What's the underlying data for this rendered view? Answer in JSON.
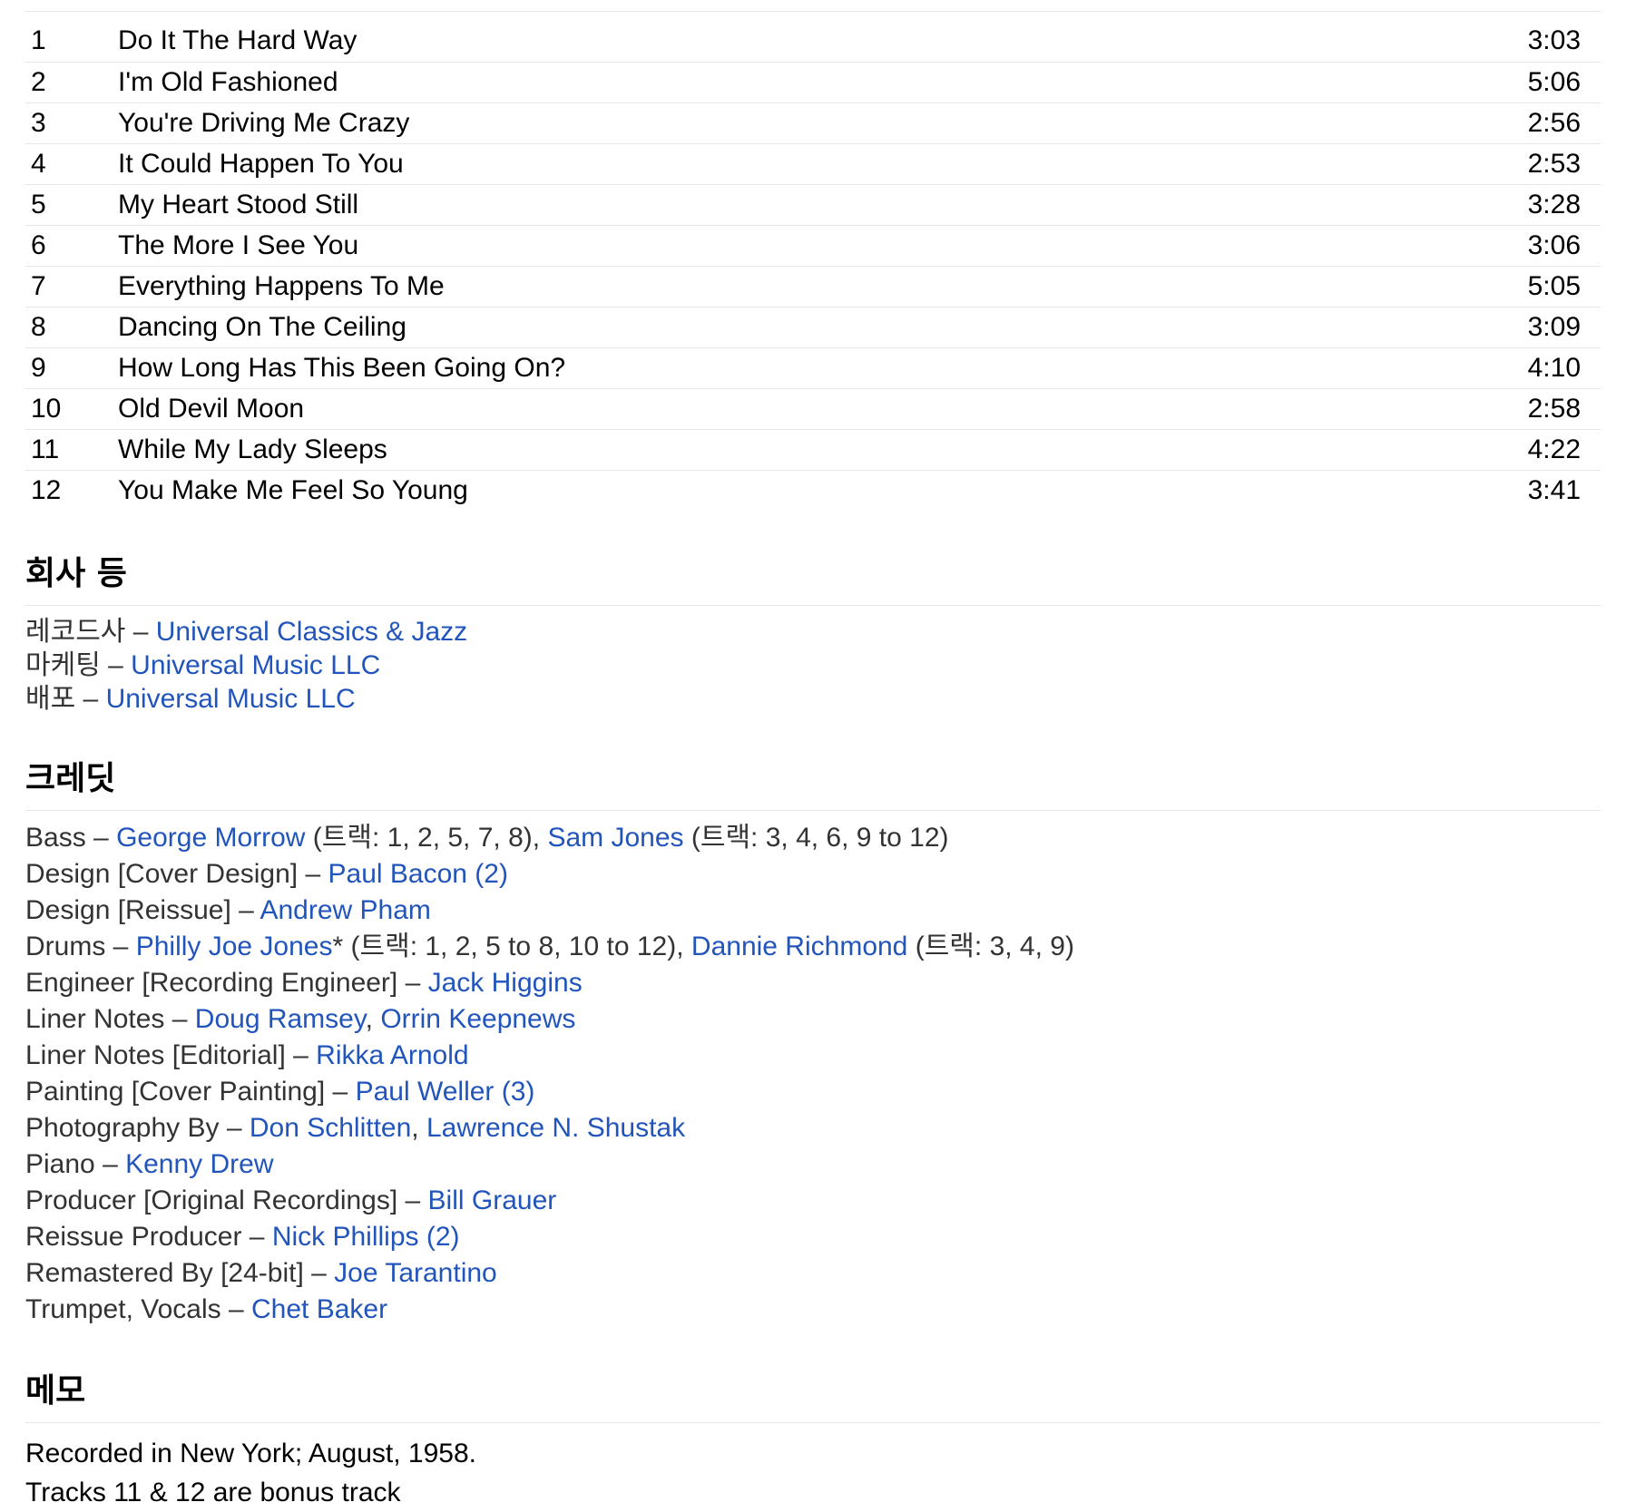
{
  "tracks": [
    {
      "position": "1",
      "title": "Do It The Hard Way",
      "duration": "3:03"
    },
    {
      "position": "2",
      "title": "I'm Old Fashioned",
      "duration": "5:06"
    },
    {
      "position": "3",
      "title": "You're Driving Me Crazy",
      "duration": "2:56"
    },
    {
      "position": "4",
      "title": "It Could Happen To You",
      "duration": "2:53"
    },
    {
      "position": "5",
      "title": "My Heart Stood Still",
      "duration": "3:28"
    },
    {
      "position": "6",
      "title": "The More I See You",
      "duration": "3:06"
    },
    {
      "position": "7",
      "title": "Everything Happens To Me",
      "duration": "5:05"
    },
    {
      "position": "8",
      "title": "Dancing On The Ceiling",
      "duration": "3:09"
    },
    {
      "position": "9",
      "title": "How Long Has This Been Going On?",
      "duration": "4:10"
    },
    {
      "position": "10",
      "title": "Old Devil Moon",
      "duration": "2:58"
    },
    {
      "position": "11",
      "title": "While My Lady Sleeps",
      "duration": "4:22"
    },
    {
      "position": "12",
      "title": "You Make Me Feel So Young",
      "duration": "3:41"
    }
  ],
  "companies": {
    "heading": "회사 등",
    "items": [
      {
        "role": "레코드사",
        "sep": " – ",
        "name": "Universal Classics & Jazz"
      },
      {
        "role": "마케팅",
        "sep": " – ",
        "name": "Universal Music LLC"
      },
      {
        "role": "배포",
        "sep": " – ",
        "name": "Universal Music LLC"
      }
    ]
  },
  "credits": {
    "heading": "크레딧",
    "items": [
      {
        "role": "Bass",
        "parts": [
          {
            "type": "link",
            "text": "George Morrow"
          },
          {
            "type": "text",
            "text": " (트랙: 1, 2, 5, 7, 8), "
          },
          {
            "type": "link",
            "text": "Sam Jones"
          },
          {
            "type": "text",
            "text": " (트랙: 3, 4, 6, 9 to 12)"
          }
        ]
      },
      {
        "role": "Design [Cover Design]",
        "parts": [
          {
            "type": "link",
            "text": "Paul Bacon (2)"
          }
        ]
      },
      {
        "role": "Design [Reissue]",
        "parts": [
          {
            "type": "link",
            "text": "Andrew Pham"
          }
        ]
      },
      {
        "role": "Drums",
        "parts": [
          {
            "type": "link",
            "text": "Philly Joe Jones"
          },
          {
            "type": "text",
            "text": "* (트랙: 1, 2, 5 to 8, 10 to 12), "
          },
          {
            "type": "link",
            "text": "Dannie Richmond"
          },
          {
            "type": "text",
            "text": " (트랙: 3, 4, 9)"
          }
        ]
      },
      {
        "role": "Engineer [Recording Engineer]",
        "parts": [
          {
            "type": "link",
            "text": "Jack Higgins"
          }
        ]
      },
      {
        "role": "Liner Notes",
        "parts": [
          {
            "type": "link",
            "text": "Doug Ramsey"
          },
          {
            "type": "text",
            "text": ", "
          },
          {
            "type": "link",
            "text": "Orrin Keepnews"
          }
        ]
      },
      {
        "role": "Liner Notes [Editorial]",
        "parts": [
          {
            "type": "link",
            "text": "Rikka Arnold"
          }
        ]
      },
      {
        "role": "Painting [Cover Painting]",
        "parts": [
          {
            "type": "link",
            "text": "Paul Weller (3)"
          }
        ]
      },
      {
        "role": "Photography By",
        "parts": [
          {
            "type": "link",
            "text": "Don Schlitten"
          },
          {
            "type": "text",
            "text": ", "
          },
          {
            "type": "link",
            "text": "Lawrence N. Shustak"
          }
        ]
      },
      {
        "role": "Piano",
        "parts": [
          {
            "type": "link",
            "text": "Kenny Drew"
          }
        ]
      },
      {
        "role": "Producer [Original Recordings]",
        "parts": [
          {
            "type": "link",
            "text": "Bill Grauer"
          }
        ]
      },
      {
        "role": "Reissue Producer",
        "parts": [
          {
            "type": "link",
            "text": "Nick Phillips (2)"
          }
        ]
      },
      {
        "role": "Remastered By [24-bit]",
        "parts": [
          {
            "type": "link",
            "text": "Joe Tarantino"
          }
        ]
      },
      {
        "role": "Trumpet, Vocals",
        "parts": [
          {
            "type": "link",
            "text": "Chet Baker"
          }
        ]
      }
    ],
    "separator": " – "
  },
  "notes": {
    "heading": "메모",
    "lines": [
      "Recorded in New York; August, 1958.",
      "Tracks 11 & 12 are bonus track"
    ]
  },
  "colors": {
    "link": "#2255bb",
    "label": "#333333",
    "rule": "#e6e6e6"
  }
}
